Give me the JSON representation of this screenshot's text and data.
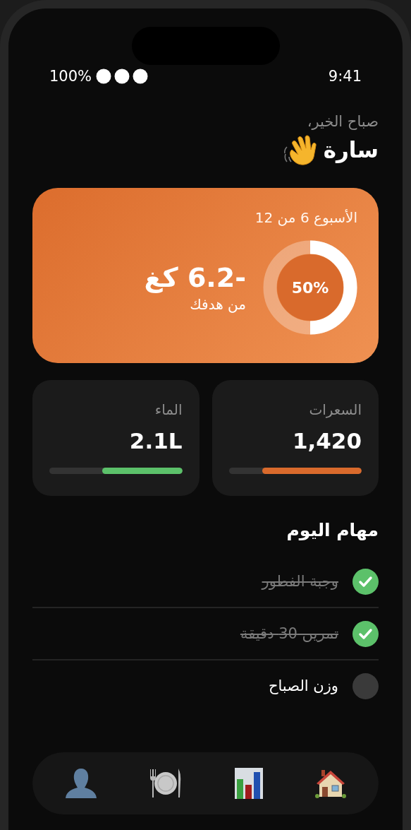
{
  "status_bar": {
    "time": "9:41",
    "battery": "100%"
  },
  "greeting": {
    "subtitle": "صباح الخير،",
    "name": "سارة"
  },
  "progress_card": {
    "week": "الأسبوع 6 من 12",
    "loss": "-6.2 كغ",
    "caption": "من هدفك",
    "level": 0.5,
    "percent": "50%"
  },
  "stats": [
    {
      "label": "السعرات",
      "value": "1,420",
      "level": 0.75,
      "color": "#d96a2c"
    },
    {
      "label": "الماء",
      "value": "2.1L",
      "level": 0.6,
      "color": "#5cc16a"
    }
  ],
  "tasks_title": "مهام اليوم",
  "tasks": [
    {
      "label": "وجبة الفطور",
      "checked": true
    },
    {
      "label": "تمرين 30 دقيقة",
      "checked": true
    },
    {
      "label": "وزن الصباح",
      "checked": false
    }
  ],
  "nav": [
    {
      "kind": "home"
    },
    {
      "kind": "stats"
    },
    {
      "kind": "meals"
    },
    {
      "kind": "profile"
    }
  ]
}
